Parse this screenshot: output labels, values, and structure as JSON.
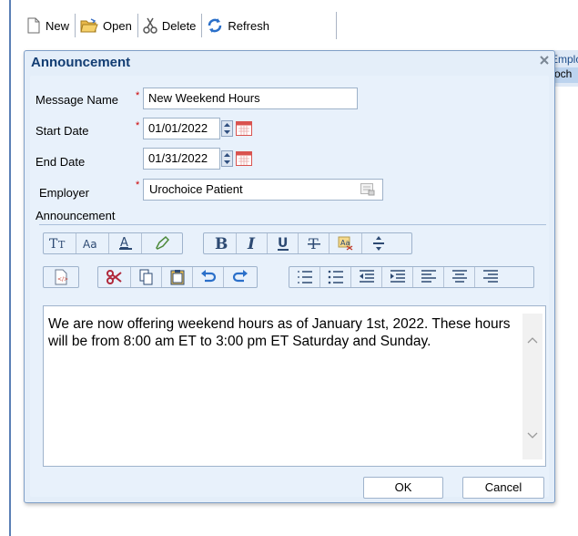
{
  "toolbar": {
    "new_label": "New",
    "open_label": "Open",
    "delete_label": "Delete",
    "refresh_label": "Refresh"
  },
  "background_grid": {
    "header_fragment": "Emplo",
    "row_fragment": "roch"
  },
  "dialog": {
    "title": "Announcement",
    "fields": {
      "message_name": {
        "label": "Message Name",
        "value": "New Weekend Hours"
      },
      "start_date": {
        "label": "Start Date",
        "value": "01/01/2022"
      },
      "end_date": {
        "label": "End Date",
        "value": "01/31/2022"
      },
      "employer": {
        "label": "Employer",
        "value": "Urochoice Patient"
      },
      "announcement": {
        "label": "Announcement"
      }
    },
    "required_marker": "*",
    "editor": {
      "text": "We are now offering weekend hours as of January 1st, 2022. These hours will be from 8:00 am ET to 3:00 pm ET Saturday and Sunday."
    },
    "buttons": {
      "ok": "OK",
      "cancel": "Cancel"
    }
  },
  "colors": {
    "dialog_bg": "#e4eef9",
    "title_text": "#123d73",
    "required": "#cc0000",
    "calendar_icon": "#d9534f"
  }
}
